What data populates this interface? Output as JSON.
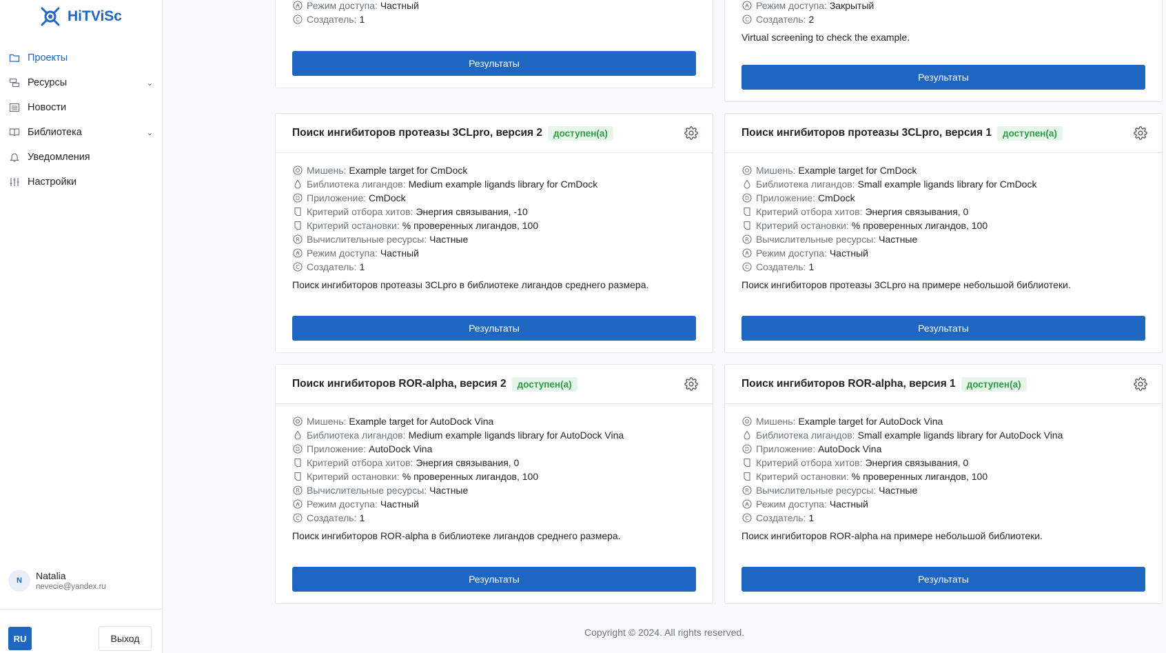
{
  "app": {
    "name": "HiTViSc"
  },
  "sidebar": {
    "items": [
      {
        "label": "Проекты",
        "icon": "folder-icon",
        "active": true
      },
      {
        "label": "Ресурсы",
        "icon": "resources-icon",
        "expandable": true
      },
      {
        "label": "Новости",
        "icon": "news-icon"
      },
      {
        "label": "Библиотека",
        "icon": "book-icon",
        "expandable": true
      },
      {
        "label": "Уведомления",
        "icon": "bell-icon"
      },
      {
        "label": "Настройки",
        "icon": "settings-sliders-icon"
      }
    ],
    "user": {
      "initial": "N",
      "name": "Natalia",
      "email": "nevecie@yandex.ru"
    },
    "lang": "RU",
    "logout": "Выход"
  },
  "labels": {
    "target": "Мишень:",
    "library": "Библиотека лигандов:",
    "app": "Приложение:",
    "hit_criterion": "Критерий отбора хитов:",
    "stop_criterion": "Критерий остановки:",
    "resources": "Вычислительные ресурсы:",
    "access": "Режим доступа:",
    "creator": "Создатель:",
    "results_button": "Результаты",
    "status": "доступен(а)"
  },
  "partial_cards": [
    {
      "access": "Частный",
      "creator": "1"
    },
    {
      "access": "Закрытый",
      "creator": "2",
      "description": "Virtual screening to check the example."
    }
  ],
  "cards": [
    {
      "title": "Поиск ингибиторов протеазы 3CLpro, версия 2",
      "target": "Example target for CmDock",
      "library": "Medium example ligands library for CmDock",
      "app": "CmDock",
      "hit_criterion": "Энергия связывания, -10",
      "stop_criterion": "% проверенных лигандов, 100",
      "resources": "Частные",
      "access": "Частный",
      "creator": "1",
      "description": "Поиск ингибиторов протеазы 3CLpro в библиотеке лигандов среднего размера."
    },
    {
      "title": "Поиск ингибиторов протеазы 3CLpro, версия 1",
      "target": "Example target for CmDock",
      "library": "Small example ligands library for CmDock",
      "app": "CmDock",
      "hit_criterion": "Энергия связывания, 0",
      "stop_criterion": "% проверенных лигандов, 100",
      "resources": "Частные",
      "access": "Частный",
      "creator": "1",
      "description": "Поиск ингибиторов протеазы 3CLpro на примере небольшой библиотеки."
    },
    {
      "title": "Поиск ингибиторов ROR-alpha, версия 2",
      "target": "Example target for AutoDock Vina",
      "library": "Medium example ligands library for AutoDock Vina",
      "app": "AutoDock Vina",
      "hit_criterion": "Энергия связывания, 0",
      "stop_criterion": "% проверенных лигандов, 100",
      "resources": "Частные",
      "access": "Частный",
      "creator": "1",
      "description": "Поиск ингибиторов ROR-alpha в библиотеке лигандов среднего размера."
    },
    {
      "title": "Поиск ингибиторов ROR-alpha, версия 1",
      "target": "Example target for AutoDock Vina",
      "library": "Small example ligands library for AutoDock Vina",
      "app": "AutoDock Vina",
      "hit_criterion": "Энергия связывания, 0",
      "stop_criterion": "% проверенных лигандов, 100",
      "resources": "Частные",
      "access": "Частный",
      "creator": "1",
      "description": "Поиск ингибиторов ROR-alpha на примере небольшой библиотеки."
    }
  ],
  "footer": "Copyright © 2024. All rights reserved.",
  "colors": {
    "primary": "#1e66c1",
    "badge_bg": "#e8f5ea",
    "badge_text": "#2a9d3f"
  }
}
